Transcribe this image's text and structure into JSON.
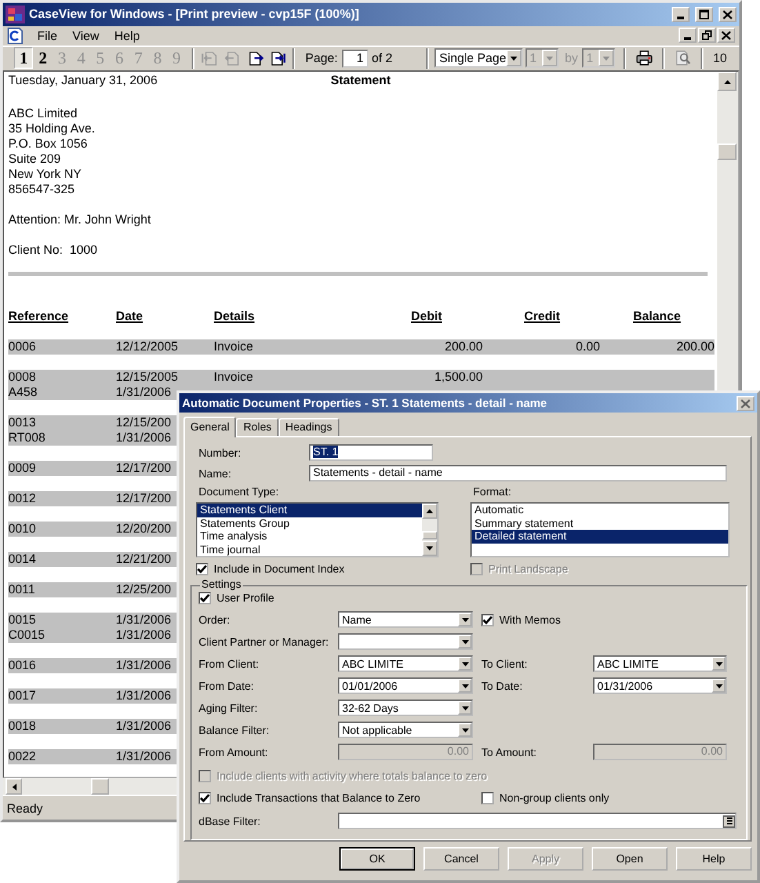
{
  "window": {
    "title": "CaseView for Windows - [Print preview - cvp15F (100%)]"
  },
  "menu": [
    "File",
    "View",
    "Help"
  ],
  "toolbar": {
    "page_buttons": [
      {
        "label": "1",
        "selected": true,
        "disabled": false
      },
      {
        "label": "2",
        "selected": false,
        "disabled": false
      },
      {
        "label": "3",
        "selected": false,
        "disabled": true
      },
      {
        "label": "4",
        "selected": false,
        "disabled": true
      },
      {
        "label": "5",
        "selected": false,
        "disabled": true
      },
      {
        "label": "6",
        "selected": false,
        "disabled": true
      },
      {
        "label": "7",
        "selected": false,
        "disabled": true
      },
      {
        "label": "8",
        "selected": false,
        "disabled": true
      },
      {
        "label": "9",
        "selected": false,
        "disabled": true
      }
    ],
    "nav_buttons": [
      {
        "kind": "first",
        "disabled": true
      },
      {
        "kind": "previous",
        "disabled": true
      },
      {
        "kind": "next",
        "disabled": false
      },
      {
        "kind": "last",
        "disabled": false
      }
    ],
    "page_label": "Page:",
    "page_value": "1",
    "page_of": "of 2",
    "view_select": {
      "value": "Single Page",
      "disabled": false
    },
    "rows_select": {
      "value": "1",
      "disabled": true
    },
    "by": {
      "label": "by",
      "disabled": true
    },
    "cols_select": {
      "value": "1",
      "disabled": true
    },
    "zoom": "10"
  },
  "statement": {
    "date": "Tuesday, January 31, 2006",
    "title": "Statement",
    "address": [
      "ABC Limited",
      "35 Holding Ave.",
      "P.O. Box 1056",
      "Suite 209",
      "New York NY",
      "856547-325"
    ],
    "attention": "Attention: Mr. John Wright",
    "client_no": {
      "label": "Client No:",
      "value": "1000"
    },
    "columns": [
      "Reference",
      "Date",
      "Details",
      "Debit",
      "Credit",
      "Balance"
    ],
    "rows": [
      {
        "lines": [
          {
            "reference": "0006",
            "date": "12/12/2005",
            "details": "Invoice",
            "debit": "200.00",
            "credit": "0.00",
            "balance": "200.00"
          }
        ]
      },
      {
        "lines": [
          {
            "reference": "0008",
            "date": "12/15/2005",
            "details": "Invoice",
            "debit": "1,500.00"
          },
          {
            "reference": "A458",
            "date": "1/31/2006"
          }
        ]
      },
      {
        "lines": [
          {
            "reference": "0013",
            "date": "12/15/200"
          },
          {
            "reference": "RT008",
            "date": "1/31/2006"
          }
        ]
      },
      {
        "lines": [
          {
            "reference": "0009",
            "date": "12/17/200"
          }
        ]
      },
      {
        "lines": [
          {
            "reference": "0012",
            "date": "12/17/200"
          }
        ]
      },
      {
        "lines": [
          {
            "reference": "0010",
            "date": "12/20/200"
          }
        ]
      },
      {
        "lines": [
          {
            "reference": "0014",
            "date": "12/21/200"
          }
        ]
      },
      {
        "lines": [
          {
            "reference": "0011",
            "date": "12/25/200"
          }
        ]
      },
      {
        "lines": [
          {
            "reference": "0015",
            "date": "1/31/2006"
          },
          {
            "reference": "C0015",
            "date": "1/31/2006"
          }
        ]
      },
      {
        "lines": [
          {
            "reference": "0016",
            "date": "1/31/2006"
          }
        ]
      },
      {
        "lines": [
          {
            "reference": "0017",
            "date": "1/31/2006"
          }
        ]
      },
      {
        "lines": [
          {
            "reference": "0018",
            "date": "1/31/2006"
          }
        ]
      },
      {
        "lines": [
          {
            "reference": "0022",
            "date": "1/31/2006"
          }
        ]
      }
    ]
  },
  "status_bar": "Ready",
  "dialog": {
    "title": "Automatic Document Properties - ST. 1 Statements - detail - name",
    "tabs": [
      {
        "label": "General",
        "selected": true
      },
      {
        "label": "Roles",
        "selected": false
      },
      {
        "label": "Headings",
        "selected": false
      }
    ],
    "number": {
      "label": "Number:",
      "value": "ST. 1",
      "text_selected": true
    },
    "name": {
      "label": "Name:",
      "value": "Statements - detail - name"
    },
    "document_type": {
      "label": "Document Type:",
      "items": [
        {
          "label": "Statements Client",
          "selected": true
        },
        {
          "label": "Statements Group",
          "selected": false
        },
        {
          "label": "Time analysis",
          "selected": false
        },
        {
          "label": "Time journal",
          "selected": false
        }
      ]
    },
    "format": {
      "label": "Format:",
      "items": [
        {
          "label": "Automatic",
          "selected": false
        },
        {
          "label": "Summary statement",
          "selected": false
        },
        {
          "label": "Detailed statement",
          "selected": true
        }
      ]
    },
    "include_in_index": {
      "label": "Include in Document Index",
      "checked": true,
      "disabled": false
    },
    "print_landscape": {
      "label": "Print Landscape",
      "checked": false,
      "disabled": true
    },
    "settings": {
      "legend": "Settings",
      "user_profile": {
        "label": "User Profile",
        "checked": true,
        "disabled": false
      },
      "rows": [
        {
          "left": {
            "kind": "dropdown",
            "label": "Order:",
            "value": "Name"
          },
          "right": {
            "kind": "checkbox",
            "label": "With Memos",
            "checked": true,
            "disabled": false
          }
        },
        {
          "left": {
            "kind": "dropdown",
            "label": "Client Partner or Manager:"
          }
        },
        {
          "left": {
            "kind": "dropdown",
            "label": "From Client:",
            "value": "ABC LIMITE"
          },
          "right": {
            "kind": "dropdown",
            "label": "To Client:",
            "value": "ABC LIMITE"
          }
        },
        {
          "left": {
            "kind": "dropdown",
            "label": "From Date:",
            "value": "01/01/2006"
          },
          "right": {
            "kind": "dropdown",
            "label": "To Date:",
            "value": "01/31/2006"
          }
        },
        {
          "left": {
            "kind": "dropdown",
            "label": "Aging Filter:",
            "value": "32-62 Days"
          }
        },
        {
          "left": {
            "kind": "dropdown",
            "label": "Balance Filter:",
            "value": "Not applicable"
          }
        },
        {
          "left": {
            "kind": "amount",
            "label": "From Amount:",
            "value": "0.00",
            "disabled": true
          },
          "right": {
            "kind": "amount",
            "label": "To Amount:",
            "value": "0.00",
            "disabled": true
          }
        }
      ],
      "option": {
        "label": "Include clients with activity where totals balance to zero",
        "checked": false,
        "disabled": true
      },
      "options_row": [
        {
          "label": "Include Transactions that Balance to Zero",
          "checked": true,
          "disabled": false
        },
        {
          "label": "Non-group clients only",
          "checked": false,
          "disabled": false
        }
      ],
      "dbase_filter": {
        "label": "dBase Filter:"
      }
    },
    "buttons": [
      {
        "label": "OK",
        "default": true,
        "disabled": false
      },
      {
        "label": "Cancel",
        "default": false,
        "disabled": false
      },
      {
        "label": "Apply",
        "default": false,
        "disabled": true
      },
      {
        "label": "Open",
        "default": false,
        "disabled": false
      },
      {
        "label": "Help",
        "default": false,
        "disabled": false
      }
    ]
  }
}
